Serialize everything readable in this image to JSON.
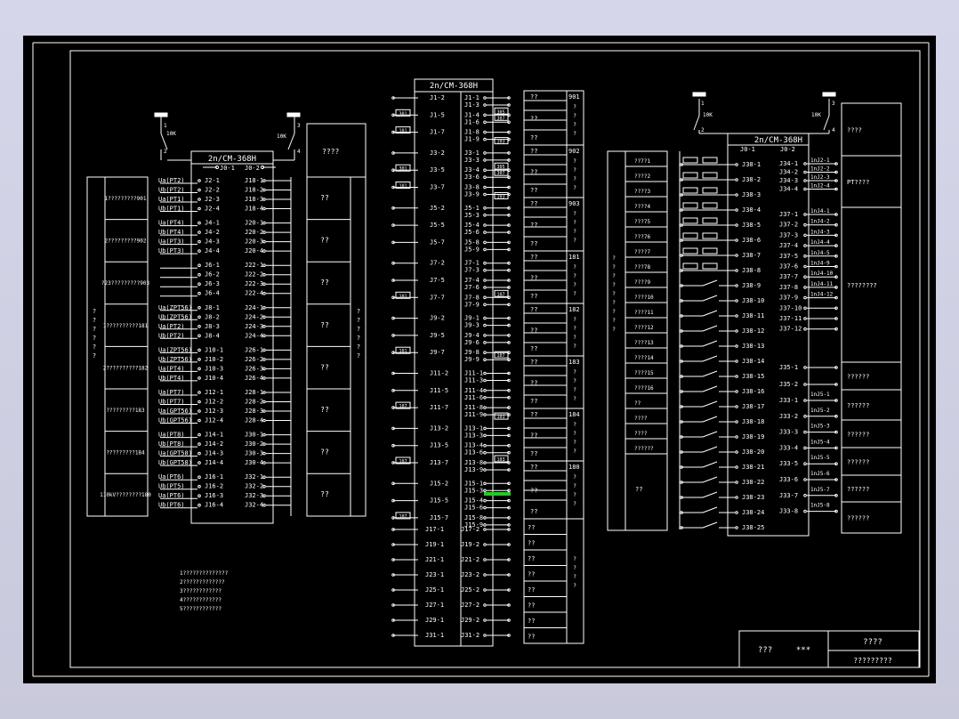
{
  "colors": {
    "background": "#000000",
    "lines": "#ffffff",
    "highlight": "#22cc22",
    "window": "#d0d0e3"
  },
  "block_a": {
    "title": "2n/CM-368H",
    "top": [
      "J0-1",
      "J0-2"
    ],
    "groups": [
      {
        "desc": "1?????????901",
        "rows": [
          [
            "Ua(PT2)",
            "J2-1",
            "J18-1"
          ],
          [
            "Ub(PT2)",
            "J2-2",
            "J18-2"
          ],
          [
            "Ua(PT1)",
            "J2-3",
            "J18-3"
          ],
          [
            "Ub(PT1)",
            "J2-4",
            "J18-4"
          ]
        ]
      },
      {
        "desc": "2?????????902",
        "rows": [
          [
            "Ua(PT4)",
            "J4-1",
            "J20-1"
          ],
          [
            "Ub(PT4)",
            "J4-2",
            "J20-2"
          ],
          [
            "Ua(PT3)",
            "J4-3",
            "J20-3"
          ],
          [
            "Ub(PT3)",
            "J4-4",
            "J20-4"
          ]
        ]
      },
      {
        "desc": "?23?????????903",
        "rows": [
          [
            "",
            "J6-1",
            "J22-1"
          ],
          [
            "",
            "J6-2",
            "J22-2"
          ],
          [
            "",
            "J6-3",
            "J22-3"
          ],
          [
            "",
            "J6-4",
            "J22-4"
          ]
        ]
      },
      {
        "desc": "1??????????181",
        "rows": [
          [
            "Ua(ZPT56)",
            "J8-1",
            "J24-1"
          ],
          [
            "Ub(ZPT56)",
            "J8-2",
            "J24-2"
          ],
          [
            "Ua(PT2)",
            "J8-3",
            "J24-3"
          ],
          [
            "Ub(PT2)",
            "J8-4",
            "J24-4"
          ]
        ]
      },
      {
        "desc": "2??????????182",
        "rows": [
          [
            "Ua(ZPT56)",
            "J10-1",
            "J26-1"
          ],
          [
            "Ub(ZPT56)",
            "J10-2",
            "J26-2"
          ],
          [
            "Ua(PT4)",
            "J10-3",
            "J26-3"
          ],
          [
            "Ub(PT4)",
            "J10-4",
            "J26-4"
          ]
        ]
      },
      {
        "desc": "?????????183",
        "rows": [
          [
            "Ua(PT7)",
            "J12-1",
            "J28-1"
          ],
          [
            "Ub(PT7)",
            "J12-2",
            "J28-2"
          ],
          [
            "Ua(GPT56)",
            "J12-3",
            "J28-3"
          ],
          [
            "Ub(GPT56)",
            "J12-4",
            "J28-4"
          ]
        ]
      },
      {
        "desc": "?????????184",
        "rows": [
          [
            "Ua(PT8)",
            "J14-1",
            "J30-1"
          ],
          [
            "Ub(PT8)",
            "J14-2",
            "J30-2"
          ],
          [
            "Ua(GPT58)",
            "J14-3",
            "J30-3"
          ],
          [
            "Ub(GPT58)",
            "J14-4",
            "J30-4"
          ]
        ]
      },
      {
        "desc": "110kV????????180",
        "rows": [
          [
            "Ua(PT6)",
            "J16-1",
            "J32-1"
          ],
          [
            "Ub(PT5)",
            "J16-2",
            "J32-2"
          ],
          [
            "Ua(PT6)",
            "J16-3",
            "J32-3"
          ],
          [
            "Ub(PT6)",
            "J16-4",
            "J32-4"
          ]
        ]
      }
    ],
    "left_vertical": "? ? ? ? ? ?",
    "right_title": "????",
    "right_cells": [
      "??",
      "??",
      "??",
      "??",
      "??",
      "??",
      "??",
      "??"
    ],
    "right_vertical": "? ? ? ? ? ?",
    "switch_labels": [
      "10K",
      "1",
      "2",
      "10K",
      "3",
      "4"
    ],
    "notes": [
      "1??????????????",
      "2?????????????",
      "3????????????",
      "4????????????",
      "5????????????"
    ]
  },
  "block_b": {
    "title": "2n/CM-368H",
    "rows": [
      {
        "l": "J1-2",
        "r": [
          "J1-1",
          "J1-3"
        ]
      },
      {
        "l": "J1-5",
        "r": [
          "J1-4",
          "J1-6"
        ],
        "tag": "301"
      },
      {
        "l": "J1-7",
        "r": [
          "J1-8",
          "J1-9"
        ],
        "tag": "101"
      },
      {
        "l": "J3-2",
        "r": [
          "J3-1",
          "J3-3"
        ]
      },
      {
        "l": "J3-5",
        "r": [
          "J3-4",
          "J3-6"
        ],
        "tag": "301"
      },
      {
        "l": "J3-7",
        "r": [
          "J3-8",
          "J3-9"
        ],
        "tag": "101"
      },
      {
        "l": "J5-2",
        "r": [
          "J5-1",
          "J5-3"
        ]
      },
      {
        "l": "J5-5",
        "r": [
          "J5-4",
          "J5-6"
        ]
      },
      {
        "l": "J5-7",
        "r": [
          "J5-8",
          "J5-9"
        ]
      },
      {
        "l": "J7-2",
        "r": [
          "J7-1",
          "J7-3"
        ]
      },
      {
        "l": "J7-5",
        "r": [
          "J7-4",
          "J7-6"
        ]
      },
      {
        "l": "J7-7",
        "r": [
          "J7-8",
          "J7-9"
        ],
        "tag": "101"
      },
      {
        "l": "J9-2",
        "r": [
          "J9-1",
          "J9-3"
        ]
      },
      {
        "l": "J9-5",
        "r": [
          "J9-4",
          "J9-6"
        ]
      },
      {
        "l": "J9-7",
        "r": [
          "J9-8",
          "J9-9"
        ],
        "tag": "101"
      },
      {
        "l": "J11-2",
        "r": [
          "J11-1",
          "J11-3"
        ]
      },
      {
        "l": "J11-5",
        "r": [
          "J11-4",
          "J11-6"
        ]
      },
      {
        "l": "J11-7",
        "r": [
          "J11-8",
          "J11-9"
        ],
        "tag": "107"
      },
      {
        "l": "J13-2",
        "r": [
          "J13-1",
          "J13-3"
        ]
      },
      {
        "l": "J13-5",
        "r": [
          "J13-4",
          "J13-6"
        ]
      },
      {
        "l": "J13-7",
        "r": [
          "J13-8",
          "J13-9"
        ],
        "tag": "107"
      },
      {
        "l": "J15-2",
        "r": [
          "J15-1",
          "J15-3"
        ]
      },
      {
        "l": "J15-5",
        "r": [
          "J15-4",
          "J15-6"
        ]
      },
      {
        "l": "J15-7",
        "r": [
          "J15-8",
          "J15-9"
        ],
        "tag": "107"
      }
    ],
    "mid_tags": [
      "305",
      "307",
      "103",
      "305",
      "307",
      "103",
      "107",
      "107",
      "103",
      "103"
    ],
    "simple_rows": [
      [
        "J17-1",
        "J17-2"
      ],
      [
        "J19-1",
        "J19-2"
      ],
      [
        "J21-1",
        "J21-2"
      ],
      [
        "J23-1",
        "J23-2"
      ],
      [
        "J25-1",
        "J25-2"
      ],
      [
        "J27-1",
        "J27-2"
      ],
      [
        "J29-1",
        "J29-2"
      ],
      [
        "J31-1",
        "J31-2"
      ]
    ],
    "group_numbers": [
      "901",
      "902",
      "903",
      "181",
      "182",
      "183",
      "184",
      "180"
    ],
    "group_label": "??",
    "group_vertical": "? ? ? ?",
    "side_vertical": "? ? ? ?"
  },
  "block_c": {
    "title": "2n/CM-368H",
    "top": [
      "J0-1",
      "J0-2"
    ],
    "left_labels": [
      "??7?1",
      "????2",
      "????3",
      "????4",
      "???75",
      "???76",
      "????7",
      "???78",
      "????9",
      "????10",
      "????11",
      "????12",
      "????13",
      "????14",
      "????15",
      "????16",
      "??",
      "????",
      "????",
      "??????",
      "??"
    ],
    "left_vertical": "? ? ? ? ? ? ? ? ?",
    "terminals": [
      "J38-1",
      "J38-2",
      "J38-3",
      "J38-4",
      "J38-5",
      "J38-6",
      "J38-7",
      "J38-8",
      "J38-9",
      "J38-10",
      "J38-11",
      "J38-12",
      "J38-13",
      "J38-14",
      "J38-15",
      "J38-16",
      "J38-17",
      "J38-18",
      "J38-19",
      "J38-20",
      "J38-21",
      "J38-22",
      "J38-23",
      "J38-24",
      "J38-25"
    ],
    "right_terms": [
      "J34-1",
      "J34-2",
      "J34-3",
      "J34-4",
      "J37-1",
      "J37-2",
      "J37-3",
      "J37-4",
      "J37-5",
      "J37-6",
      "J37-7",
      "J37-8",
      "J37-9",
      "J37-10",
      "J37-11",
      "J37-12",
      "J35-1",
      "J35-2",
      "J33-1",
      "J33-2",
      "J33-3",
      "J33-4",
      "J33-5",
      "J33-6",
      "J33-7",
      "J33-8"
    ],
    "right_tags": [
      "1nJ2-1",
      "1nJ2-2",
      "1nJ2-3",
      "1nJ2-4",
      "1nJ4-1",
      "1nJ4-2",
      "1nJ4-3",
      "1nJ4-4",
      "1nJ4-5",
      "1nJ4-9",
      "1nJ4-10",
      "1nJ4-11",
      "1nJ4-12",
      "1nJ5-1",
      "1nJ5-2",
      "1nJ5-3",
      "1nJ5-4",
      "1nJ5-5",
      "1nJ5-6",
      "1nJ5-7",
      "1nJ5-8"
    ],
    "right_cells": [
      "????",
      "PT????",
      "????????",
      "??????",
      "??????",
      "??????",
      "??????",
      "??????",
      "??????"
    ],
    "switch_labels": [
      "10K",
      "1",
      "2",
      "10K",
      "3",
      "4"
    ]
  },
  "title_block": {
    "cell1": "???",
    "cell2": "***",
    "cell3": "????",
    "cell4": "?????????"
  }
}
